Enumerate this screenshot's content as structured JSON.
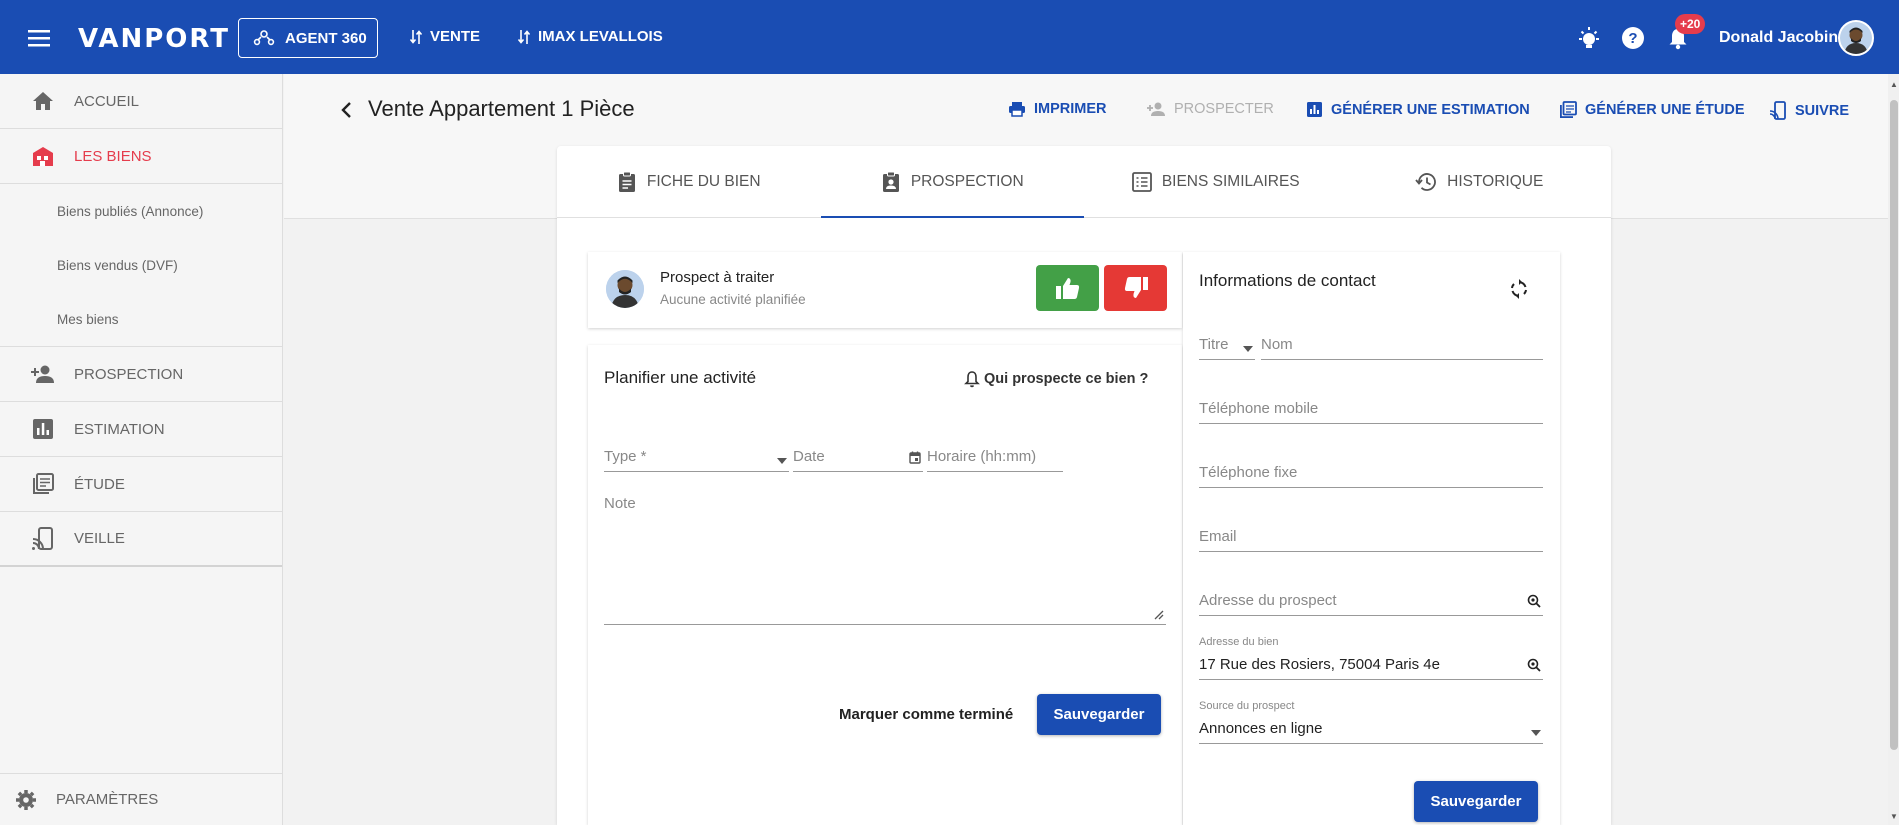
{
  "topbar": {
    "logo": "VANPORT",
    "agent_label": "AGENT 360",
    "links": [
      "VENTE",
      "IMAX LEVALLOIS"
    ],
    "notif_badge": "+20",
    "user_name": "Donald Jacobin",
    "bg_color": "#1a4db3"
  },
  "sidebar": {
    "items": [
      {
        "label": "ACCUEIL",
        "icon": "home-icon"
      },
      {
        "label": "LES BIENS",
        "icon": "buildings-icon",
        "active": true
      },
      {
        "label": "PROSPECTION",
        "icon": "person-add-icon"
      },
      {
        "label": "ESTIMATION",
        "icon": "bar-chart-icon"
      },
      {
        "label": "ÉTUDE",
        "icon": "library-icon"
      },
      {
        "label": "VEILLE",
        "icon": "phone-cast-icon"
      }
    ],
    "sub_items": [
      "Biens publiés (Annonce)",
      "Biens vendus (DVF)",
      "Mes biens"
    ],
    "settings_label": "PARAMÈTRES",
    "active_color": "#e53c4c"
  },
  "header": {
    "title": "Vente Appartement 1 Pièce",
    "actions": [
      {
        "label": "IMPRIMER",
        "icon": "printer-icon"
      },
      {
        "label": "PROSPECTER",
        "icon": "person-add-icon",
        "disabled": true
      },
      {
        "label": "GÉNÉRER UNE ESTIMATION",
        "icon": "bar-chart-icon"
      },
      {
        "label": "GÉNÉRER UNE ÉTUDE",
        "icon": "library-icon"
      },
      {
        "label": "SUIVRE",
        "icon": "phone-cast-icon"
      }
    ]
  },
  "tabs": [
    {
      "label": "FICHE DU BIEN",
      "icon": "clipboard-icon"
    },
    {
      "label": "PROSPECTION",
      "icon": "badge-icon",
      "active": true
    },
    {
      "label": "BIENS SIMILAIRES",
      "icon": "list-icon"
    },
    {
      "label": "HISTORIQUE",
      "icon": "history-icon"
    }
  ],
  "prospect": {
    "title": "Prospect à traiter",
    "subtitle": "Aucune activité planifiée"
  },
  "activity": {
    "title": "Planifier une activité",
    "who_link": "Qui prospecte ce bien ?",
    "type_placeholder": "Type *",
    "date_placeholder": "Date",
    "time_placeholder": "Horaire (hh:mm)",
    "note_placeholder": "Note",
    "mark_done": "Marquer comme terminé",
    "save": "Sauvegarder"
  },
  "contact": {
    "title": "Informations de contact",
    "titre_placeholder": "Titre",
    "nom_placeholder": "Nom",
    "mobile_placeholder": "Téléphone mobile",
    "fixe_placeholder": "Téléphone fixe",
    "email_placeholder": "Email",
    "address_placeholder": "Adresse du prospect",
    "property_address_label": "Adresse du bien",
    "property_address_value": "17 Rue des Rosiers, 75004 Paris 4e",
    "source_label": "Source du prospect",
    "source_value": "Annonces en ligne",
    "save": "Sauvegarder"
  }
}
